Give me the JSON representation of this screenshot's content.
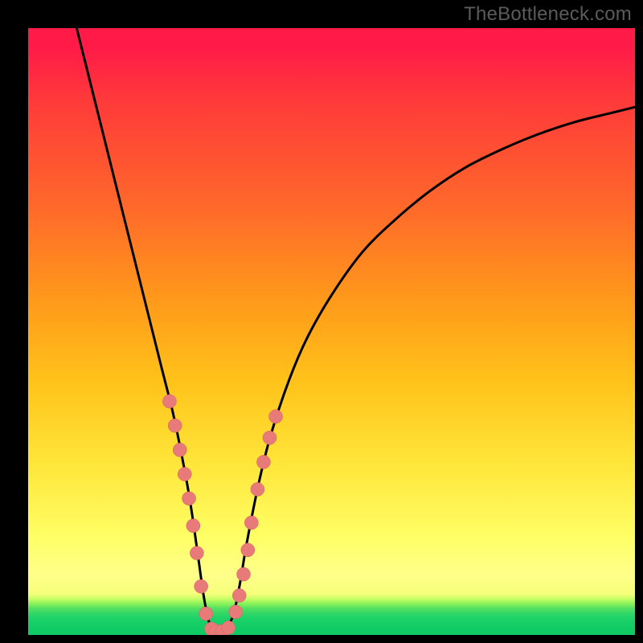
{
  "watermark": "TheBottleneck.com",
  "colors": {
    "frame": "#000000",
    "gradient_top": "#ff1a48",
    "gradient_mid": "#ffe63a",
    "gradient_bottom": "#0fcb63",
    "curve": "#000000",
    "marker_fill": "#e97a7a",
    "marker_stroke": "#d46060"
  },
  "chart_data": {
    "type": "line",
    "title": "",
    "xlabel": "",
    "ylabel": "",
    "xlim": [
      0,
      100
    ],
    "ylim": [
      0,
      100
    ],
    "grid": false,
    "legend": false,
    "series": [
      {
        "name": "bottleneck-curve",
        "x": [
          8,
          10,
          12,
          14,
          16,
          18,
          20,
          22,
          24,
          26,
          27,
          28,
          29,
          30,
          31,
          32,
          33,
          34,
          35,
          36,
          38,
          40,
          43,
          46,
          50,
          55,
          60,
          66,
          72,
          78,
          84,
          90,
          96,
          100
        ],
        "y": [
          100,
          92,
          84,
          76,
          68,
          60,
          52,
          44,
          36,
          26,
          20,
          13,
          6,
          1.5,
          0.5,
          0.5,
          1.5,
          4,
          9,
          15,
          25,
          33,
          42,
          49,
          56,
          63,
          68,
          73,
          77,
          80,
          82.5,
          84.5,
          86,
          87
        ]
      }
    ],
    "markers": {
      "name": "highlighted-points",
      "x": [
        23.3,
        24.2,
        25.0,
        25.8,
        26.5,
        27.2,
        27.8,
        28.5,
        29.3,
        30.2,
        31.0,
        32.0,
        33.0,
        34.2,
        34.8,
        35.5,
        36.2,
        36.8,
        37.8,
        38.8,
        39.8,
        40.8
      ],
      "y": [
        38.5,
        34.5,
        30.5,
        26.5,
        22.5,
        18.0,
        13.5,
        8.0,
        3.5,
        1.0,
        0.6,
        0.6,
        1.2,
        3.8,
        6.5,
        10.0,
        14.0,
        18.5,
        24.0,
        28.5,
        32.5,
        36.0
      ]
    }
  }
}
